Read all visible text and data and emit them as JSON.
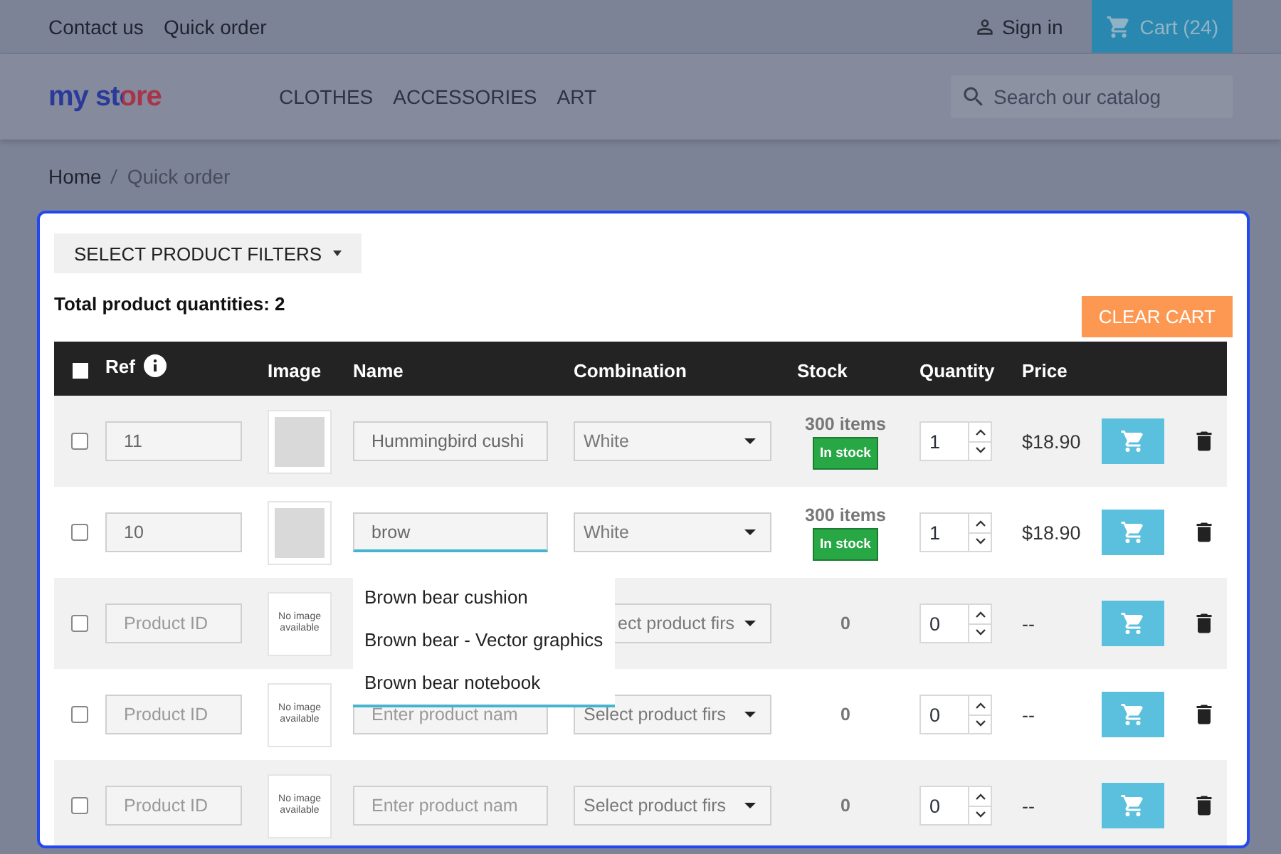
{
  "top_bar": {
    "links": [
      "Contact us",
      "Quick order"
    ],
    "sign_in": "Sign in",
    "cart": "Cart (24)"
  },
  "header": {
    "logo": "my store",
    "menu": [
      "CLOTHES",
      "ACCESSORIES",
      "ART"
    ],
    "search": {
      "placeholder": "Search our catalog"
    }
  },
  "breadcrumb": [
    "Home",
    "Quick order"
  ],
  "quick_order": {
    "filters_button": "SELECT PRODUCT FILTERS",
    "total": "Total product quantities: 2",
    "clear_button": "CLEAR CART",
    "select_all_checked": false,
    "columns": [
      "Ref",
      "Image",
      "Name",
      "Combination",
      "Stock",
      "Quantity",
      "Price"
    ],
    "rows": [
      {
        "checked": false,
        "ref": {
          "value": "11"
        },
        "image": {
          "kind": "photo"
        },
        "name": {
          "value": "Hummingbird cushi"
        },
        "combination": "White",
        "stock": "300 items",
        "stock_badge": "In stock",
        "quantity": "1",
        "price": "$18.90"
      },
      {
        "checked": false,
        "ref": {
          "value": "10"
        },
        "image": {
          "kind": "photo"
        },
        "name": {
          "value": "brow",
          "suggestions": [
            "Brown bear cushion",
            "Brown bear - Vector graphics",
            "Brown bear notebook"
          ]
        },
        "combination": "White",
        "stock": "300 items",
        "stock_badge": "In stock",
        "quantity": "1",
        "price": "$18.90"
      },
      {
        "checked": false,
        "ref": {
          "placeholder": "Product ID"
        },
        "image": {
          "kind": "empty",
          "text": "No image available"
        },
        "combination": "ect product firs",
        "stock": "0",
        "quantity": "0",
        "price": "--"
      },
      {
        "checked": false,
        "ref": {
          "placeholder": "Product ID"
        },
        "image": {
          "kind": "empty",
          "text": "No image available"
        },
        "name": {
          "placeholder": "Enter product nam"
        },
        "combination": "Select product firs",
        "stock": "0",
        "quantity": "0",
        "price": "--"
      },
      {
        "checked": false,
        "ref": {
          "placeholder": "Product ID"
        },
        "image": {
          "kind": "empty",
          "text": "No image available"
        },
        "name": {
          "placeholder": "Enter product nam"
        },
        "combination": "Select product firs",
        "stock": "0",
        "quantity": "0",
        "price": "--"
      }
    ]
  }
}
